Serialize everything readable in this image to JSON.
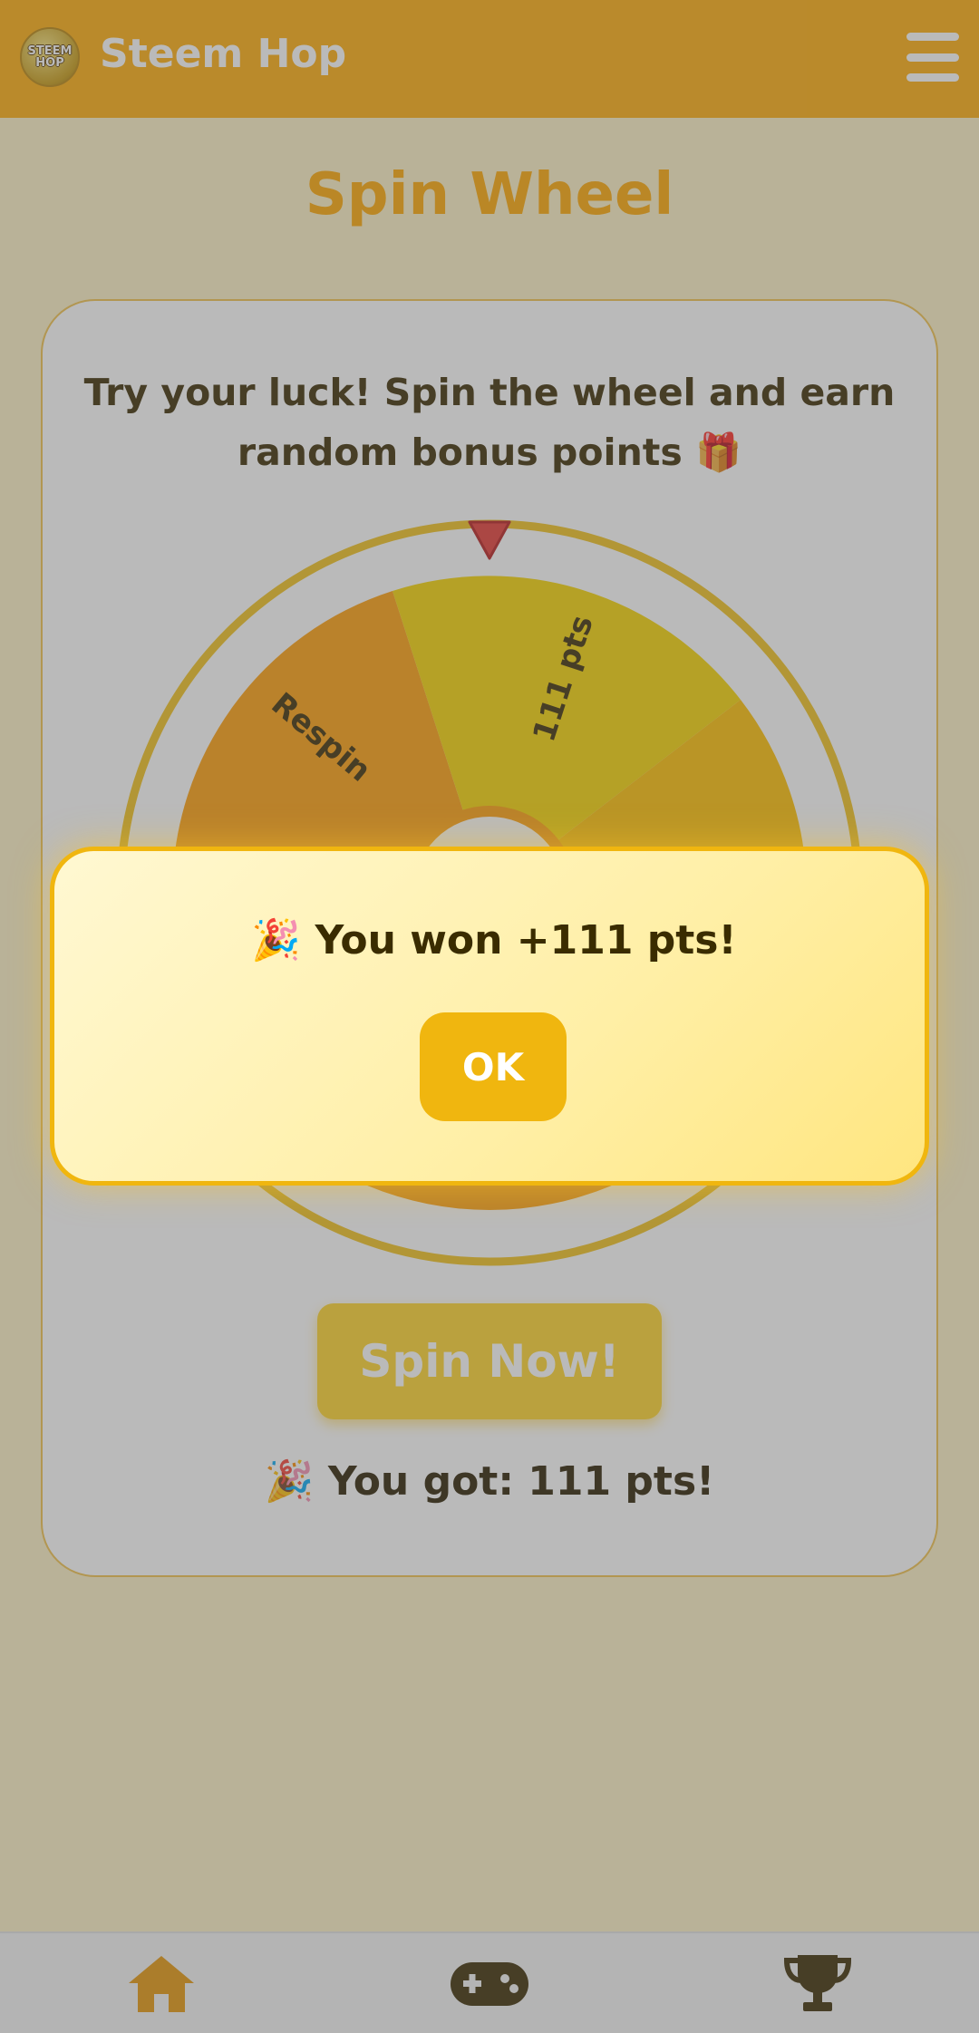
{
  "header": {
    "logo_text_line1": "STEEM",
    "logo_text_line2": "HOP",
    "app_title": "Steem Hop",
    "menu_icon": "hamburger-menu-icon"
  },
  "page": {
    "title": "Spin Wheel",
    "intro_line1": "Try your luck! Spin the wheel and earn",
    "intro_line2": "random bonus points 🎁"
  },
  "wheel": {
    "visible_segments": [
      {
        "label": "Respin",
        "color": "#ff9f0a"
      },
      {
        "label": "111 pts",
        "color": "#f7d400"
      },
      {
        "label": "",
        "color": "#ffbf00"
      }
    ],
    "rim_color": "#f2c21c",
    "pointer_color": "#e53935"
  },
  "spin_button": {
    "label": "Spin Now!"
  },
  "result": {
    "text": "🎉 You got: 111 pts!"
  },
  "modal": {
    "message": "🎉 You won +111 pts!",
    "ok_label": "OK"
  },
  "bottom_nav": {
    "items": [
      {
        "icon": "home-icon"
      },
      {
        "icon": "gamepad-icon"
      },
      {
        "icon": "trophy-icon"
      }
    ]
  },
  "colors": {
    "header_bg": "#ffac0a",
    "accent": "#ffa800",
    "button": "#ffd42a",
    "nav_icon": "#e6960a"
  }
}
